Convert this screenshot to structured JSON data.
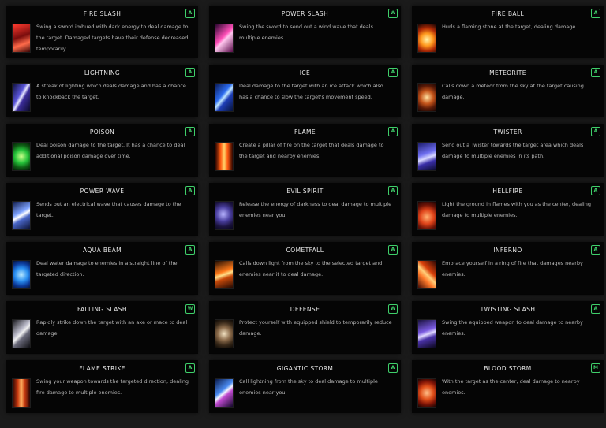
{
  "skills": [
    {
      "name": "FIRE SLASH",
      "badge": "A",
      "icon": "fire-slash-icon",
      "desc": "Swing a sword imbued with dark energy to deal damage to the target. Damaged targets have their defense decreased temporarily."
    },
    {
      "name": "POWER SLASH",
      "badge": "W",
      "icon": "power-slash-icon",
      "desc": "Swing the sword to send out a wind wave that deals multiple enemies."
    },
    {
      "name": "FIRE BALL",
      "badge": "A",
      "icon": "fire-ball-icon",
      "desc": "Hurls a flaming stone at the target, dealing damage."
    },
    {
      "name": "LIGHTNING",
      "badge": "A",
      "icon": "lightning-icon",
      "desc": "A streak of lighting which deals damage and has a chance to knockback the target."
    },
    {
      "name": "ICE",
      "badge": "A",
      "icon": "ice-icon",
      "desc": "Deal damage to the target with an ice attack which also has a chance to slow the target's movement speed."
    },
    {
      "name": "METEORITE",
      "badge": "A",
      "icon": "meteorite-icon",
      "desc": "Calls down a meteor from the sky at the target causing damage."
    },
    {
      "name": "POISON",
      "badge": "A",
      "icon": "poison-icon",
      "desc": "Deal poison damage to the target. It has a chance to deal additional poison damage over time."
    },
    {
      "name": "FLAME",
      "badge": "A",
      "icon": "flame-icon",
      "desc": "Create a pillar of fire on the target that deals damage to the target and nearby enemies."
    },
    {
      "name": "TWISTER",
      "badge": "A",
      "icon": "twister-icon",
      "desc": "Send out a Twister towards the target area which deals damage to multiple enemies in its path."
    },
    {
      "name": "POWER WAVE",
      "badge": "A",
      "icon": "power-wave-icon",
      "desc": "Sends out an electrical wave that causes damage to the target."
    },
    {
      "name": "EVIL SPIRIT",
      "badge": "A",
      "icon": "evil-spirit-icon",
      "desc": "Release the energy of darkness to deal damage to multiple enemies near you."
    },
    {
      "name": "HELLFIRE",
      "badge": "A",
      "icon": "hellfire-icon",
      "desc": "Light the ground in flames with you as the center, dealing damage to multiple enemies."
    },
    {
      "name": "AQUA BEAM",
      "badge": "A",
      "icon": "aqua-beam-icon",
      "desc": "Deal water damage to enemies in a straight line of the targeted direction."
    },
    {
      "name": "COMETFALL",
      "badge": "A",
      "icon": "cometfall-icon",
      "desc": "Calls down light from the sky to the selected target and enemies near it to deal damage."
    },
    {
      "name": "INFERNO",
      "badge": "A",
      "icon": "inferno-icon",
      "desc": "Embrace yourself in a ring of fire that damages nearby enemies."
    },
    {
      "name": "FALLING SLASH",
      "badge": "W",
      "icon": "falling-slash-icon",
      "desc": "Rapidly strike down the target with an axe or mace to deal damage."
    },
    {
      "name": "DEFENSE",
      "badge": "W",
      "icon": "defense-icon",
      "desc": "Protect yourself with equipped shield to temporarily reduce damage."
    },
    {
      "name": "TWISTING SLASH",
      "badge": "A",
      "icon": "twisting-slash-icon",
      "desc": "Swing the equipped weapon to deal damage to nearby enemies."
    },
    {
      "name": "FLAME STRIKE",
      "badge": "A",
      "icon": "flame-strike-icon",
      "desc": "Swing your weapon towards the targeted direction, dealing fire damage to multiple enemies."
    },
    {
      "name": "GIGANTIC STORM",
      "badge": "A",
      "icon": "gigantic-storm-icon",
      "desc": "Call lightning from the sky to deal damage to multiple enemies near you."
    },
    {
      "name": "BLOOD STORM",
      "badge": "M",
      "icon": "blood-storm-icon",
      "desc": "With the target as the center, deal damage to nearby enemies."
    }
  ],
  "colors": {
    "background": "#1b1b1b",
    "card": "#050505",
    "badge": "#3fcf6a",
    "title": "#e8e8e8",
    "text": "#b9b9b9"
  }
}
